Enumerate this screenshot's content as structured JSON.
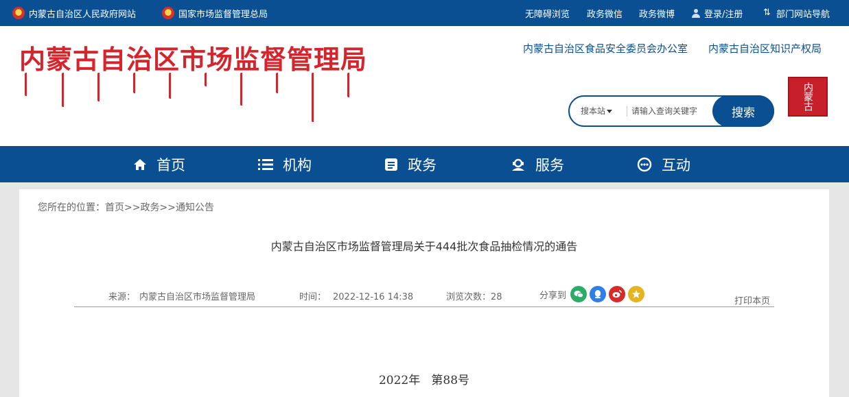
{
  "topbar": {
    "left_links": [
      {
        "label": "内蒙古自治区人民政府网站"
      },
      {
        "label": "国家市场监督管理总局"
      }
    ],
    "right_links": [
      {
        "label": "无障碍浏览"
      },
      {
        "label": "政务微信"
      },
      {
        "label": "政务微博"
      },
      {
        "label": "登录/注册"
      },
      {
        "label": "部门网站导航"
      }
    ]
  },
  "header": {
    "site_title": "内蒙古自治区市场监督管理局",
    "related_links": [
      {
        "label": "内蒙古自治区食品安全委员会办公室"
      },
      {
        "label": "内蒙古自治区知识产权局"
      }
    ],
    "seal_text": "内蒙古"
  },
  "search": {
    "scope_label": "搜本站",
    "placeholder": "请输入查询关键字",
    "button_label": "搜索"
  },
  "nav": {
    "items": [
      {
        "label": "首页",
        "icon": "home-icon"
      },
      {
        "label": "机构",
        "icon": "list-icon"
      },
      {
        "label": "政务",
        "icon": "document-icon"
      },
      {
        "label": "服务",
        "icon": "service-icon"
      },
      {
        "label": "互动",
        "icon": "chat-icon"
      }
    ]
  },
  "breadcrumb": {
    "prefix": "您所在的位置：",
    "items": [
      "首页",
      "政务",
      "通知公告"
    ],
    "separator": ">>"
  },
  "article": {
    "title": "内蒙古自治区市场监督管理局关于444批次食品抽检情况的通告",
    "source_label": "来源：",
    "source_value": "内蒙古自治区市场监督管理局",
    "time_label": "时间：",
    "time_value": "2022-12-16 14:38",
    "views_label": "浏览次数：",
    "views_value": "28",
    "share_label": "分享到",
    "print_label": "打印本页",
    "doc_number": "2022年   第88号"
  },
  "colors": {
    "brand_blue": "#0a4f91",
    "title_red": "#d6242c",
    "wechat": "#2aae67",
    "qq": "#2f7fe6",
    "weibo": "#d52c2b",
    "qzone": "#e4b520"
  }
}
